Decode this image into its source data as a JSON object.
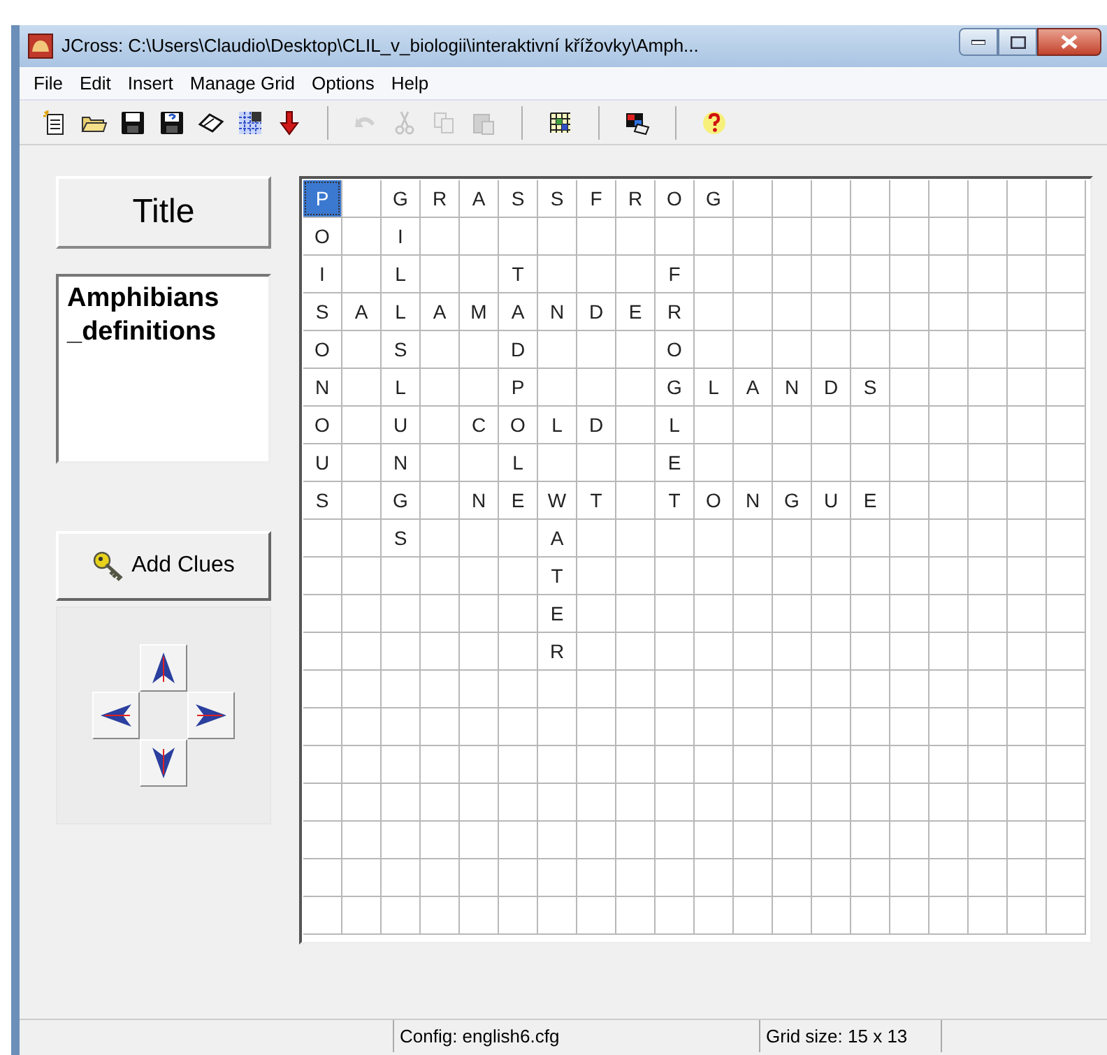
{
  "window": {
    "title": "JCross: C:\\Users\\Claudio\\Desktop\\CLIL_v_biologii\\interaktivní křížovky\\Amph..."
  },
  "menu": [
    "File",
    "Edit",
    "Insert",
    "Manage Grid",
    "Options",
    "Help"
  ],
  "toolbar": [
    [
      {
        "kind": "new",
        "disabled": false
      },
      {
        "kind": "open",
        "disabled": false
      },
      {
        "kind": "save",
        "disabled": false
      },
      {
        "kind": "saveas",
        "disabled": false
      },
      {
        "kind": "eraser",
        "disabled": false
      },
      {
        "kind": "puzzle",
        "disabled": false
      },
      {
        "kind": "down",
        "disabled": false
      }
    ],
    [
      {
        "kind": "undo",
        "disabled": true
      },
      {
        "kind": "cut",
        "disabled": true
      },
      {
        "kind": "copy",
        "disabled": true
      },
      {
        "kind": "paste",
        "disabled": true
      }
    ],
    [
      {
        "kind": "grid",
        "disabled": false
      }
    ],
    [
      {
        "kind": "picture",
        "disabled": false
      }
    ],
    [
      {
        "kind": "help",
        "disabled": false
      }
    ]
  ],
  "title_button": "Title",
  "title_text": "Amphibians _definitions",
  "add_clues": "Add Clues",
  "grid": {
    "rows": [
      [
        {
          "letter": "P",
          "selected": true
        },
        null,
        {
          "letter": "G",
          "selected": false
        },
        {
          "letter": "R",
          "selected": false
        },
        {
          "letter": "A",
          "selected": false
        },
        {
          "letter": "S",
          "selected": false
        },
        {
          "letter": "S",
          "selected": false
        },
        {
          "letter": "F",
          "selected": false
        },
        {
          "letter": "R",
          "selected": false
        },
        {
          "letter": "O",
          "selected": false
        },
        {
          "letter": "G",
          "selected": false
        }
      ],
      [
        {
          "letter": "O",
          "selected": false
        },
        null,
        {
          "letter": "I",
          "selected": false
        }
      ],
      [
        {
          "letter": "I",
          "selected": false
        },
        null,
        {
          "letter": "L",
          "selected": false
        },
        null,
        null,
        {
          "letter": "T",
          "selected": false
        },
        null,
        null,
        null,
        {
          "letter": "F",
          "selected": false
        }
      ],
      [
        {
          "letter": "S",
          "selected": false
        },
        {
          "letter": "A",
          "selected": false
        },
        {
          "letter": "L",
          "selected": false
        },
        {
          "letter": "A",
          "selected": false
        },
        {
          "letter": "M",
          "selected": false
        },
        {
          "letter": "A",
          "selected": false
        },
        {
          "letter": "N",
          "selected": false
        },
        {
          "letter": "D",
          "selected": false
        },
        {
          "letter": "E",
          "selected": false
        },
        {
          "letter": "R",
          "selected": false
        }
      ],
      [
        {
          "letter": "O",
          "selected": false
        },
        null,
        {
          "letter": "S",
          "selected": false
        },
        null,
        null,
        {
          "letter": "D",
          "selected": false
        },
        null,
        null,
        null,
        {
          "letter": "O",
          "selected": false
        }
      ],
      [
        {
          "letter": "N",
          "selected": false
        },
        null,
        {
          "letter": "L",
          "selected": false
        },
        null,
        null,
        {
          "letter": "P",
          "selected": false
        },
        null,
        null,
        null,
        {
          "letter": "G",
          "selected": false
        },
        {
          "letter": "L",
          "selected": false
        },
        {
          "letter": "A",
          "selected": false
        },
        {
          "letter": "N",
          "selected": false
        },
        {
          "letter": "D",
          "selected": false
        },
        {
          "letter": "S",
          "selected": false
        }
      ],
      [
        {
          "letter": "O",
          "selected": false
        },
        null,
        {
          "letter": "U",
          "selected": false
        },
        null,
        {
          "letter": "C",
          "selected": false
        },
        {
          "letter": "O",
          "selected": false
        },
        {
          "letter": "L",
          "selected": false
        },
        {
          "letter": "D",
          "selected": false
        },
        null,
        {
          "letter": "L",
          "selected": false
        }
      ],
      [
        {
          "letter": "U",
          "selected": false
        },
        null,
        {
          "letter": "N",
          "selected": false
        },
        null,
        null,
        {
          "letter": "L",
          "selected": false
        },
        null,
        null,
        null,
        {
          "letter": "E",
          "selected": false
        }
      ],
      [
        {
          "letter": "S",
          "selected": false
        },
        null,
        {
          "letter": "G",
          "selected": false
        },
        null,
        {
          "letter": "N",
          "selected": false
        },
        {
          "letter": "E",
          "selected": false
        },
        {
          "letter": "W",
          "selected": false
        },
        {
          "letter": "T",
          "selected": false
        },
        null,
        {
          "letter": "T",
          "selected": false
        },
        {
          "letter": "O",
          "selected": false
        },
        {
          "letter": "N",
          "selected": false
        },
        {
          "letter": "G",
          "selected": false
        },
        {
          "letter": "U",
          "selected": false
        },
        {
          "letter": "E",
          "selected": false
        }
      ],
      [
        null,
        null,
        {
          "letter": "S",
          "selected": false
        },
        null,
        null,
        null,
        {
          "letter": "A",
          "selected": false
        }
      ],
      [
        null,
        null,
        null,
        null,
        null,
        null,
        {
          "letter": "T",
          "selected": false
        }
      ],
      [
        null,
        null,
        null,
        null,
        null,
        null,
        {
          "letter": "E",
          "selected": false
        }
      ],
      [
        null,
        null,
        null,
        null,
        null,
        null,
        {
          "letter": "R",
          "selected": false
        }
      ]
    ]
  },
  "status_bar": {
    "config": "Config: english6.cfg",
    "grid_size": "Grid size: 15 x 13"
  }
}
